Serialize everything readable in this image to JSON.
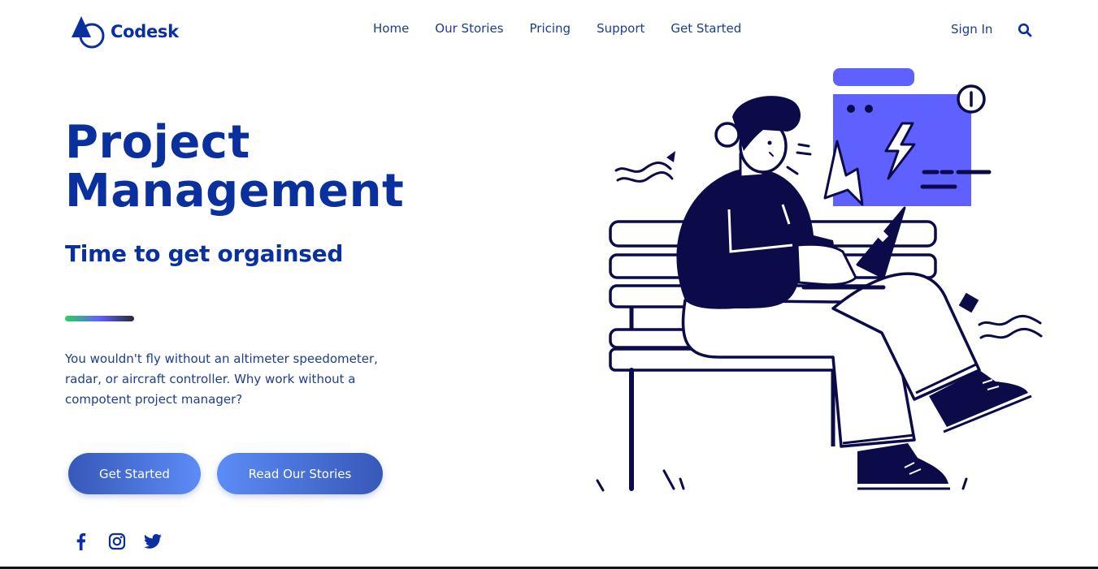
{
  "brand": {
    "name": "Codesk",
    "color": "#0a2f9e"
  },
  "nav": {
    "items": [
      "Home",
      "Our Stories",
      "Pricing",
      "Support",
      "Get Started"
    ],
    "sign_in": "Sign In",
    "search_icon": "search-icon"
  },
  "hero": {
    "title_line1": "Project",
    "title_line2": "Management",
    "subtitle": "Time to get orgainsed",
    "description": "You wouldn't fly without an altimeter speedometer, radar, or aircraft controller. Why work without a compotent project manager?",
    "accent_gradient": [
      "#27d45a",
      "#5e61ff",
      "#2a2a3a"
    ]
  },
  "buttons": {
    "get_started": "Get Started",
    "read_stories": "Read Our Stories"
  },
  "social": {
    "icons": [
      "facebook-icon",
      "instagram-icon",
      "twitter-icon"
    ]
  },
  "illustration": {
    "subject": "person-on-bench-with-laptop",
    "primary_color": "#0b0b4a",
    "accent_color": "#5e61ff"
  }
}
